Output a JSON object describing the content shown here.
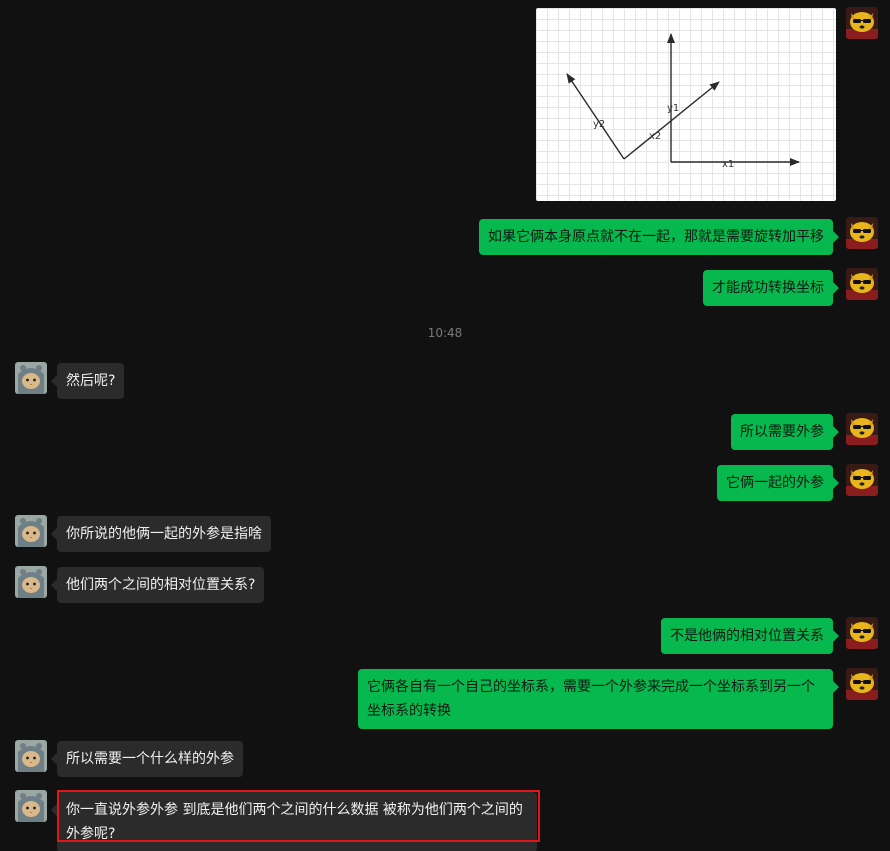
{
  "colors": {
    "background": "#111111",
    "my_bubble": "#07b84f",
    "other_bubble": "#2b2b2b",
    "highlight": "#e0161b"
  },
  "image_message": {
    "labels": {
      "y2": "y2",
      "x2": "x2",
      "y1": "y1",
      "x1": "x1"
    }
  },
  "timestamp": "10:48",
  "messages": [
    {
      "from": "me",
      "text": "如果它俩本身原点就不在一起，那就是需要旋转加平移"
    },
    {
      "from": "me",
      "text": "才能成功转换坐标"
    },
    {
      "from": "other",
      "text": "然后呢?"
    },
    {
      "from": "me",
      "text": "所以需要外参"
    },
    {
      "from": "me",
      "text": "它俩一起的外参"
    },
    {
      "from": "other",
      "text": "你所说的他俩一起的外参是指啥"
    },
    {
      "from": "other",
      "text": "他们两个之间的相对位置关系?"
    },
    {
      "from": "me",
      "text": "不是他俩的相对位置关系"
    },
    {
      "from": "me",
      "text": "它俩各自有一个自己的坐标系，需要一个外参来完成一个坐标系到另一个坐标系的转换"
    },
    {
      "from": "other",
      "text": "所以需要一个什么样的外参"
    },
    {
      "from": "other",
      "text": "你一直说外参外参  到底是他们两个之间的什么数据  被称为他们两个之间的外参呢?"
    }
  ],
  "avatars": {
    "me": "dog-with-sunglasses-avatar",
    "other": "cat-in-hood-avatar"
  }
}
